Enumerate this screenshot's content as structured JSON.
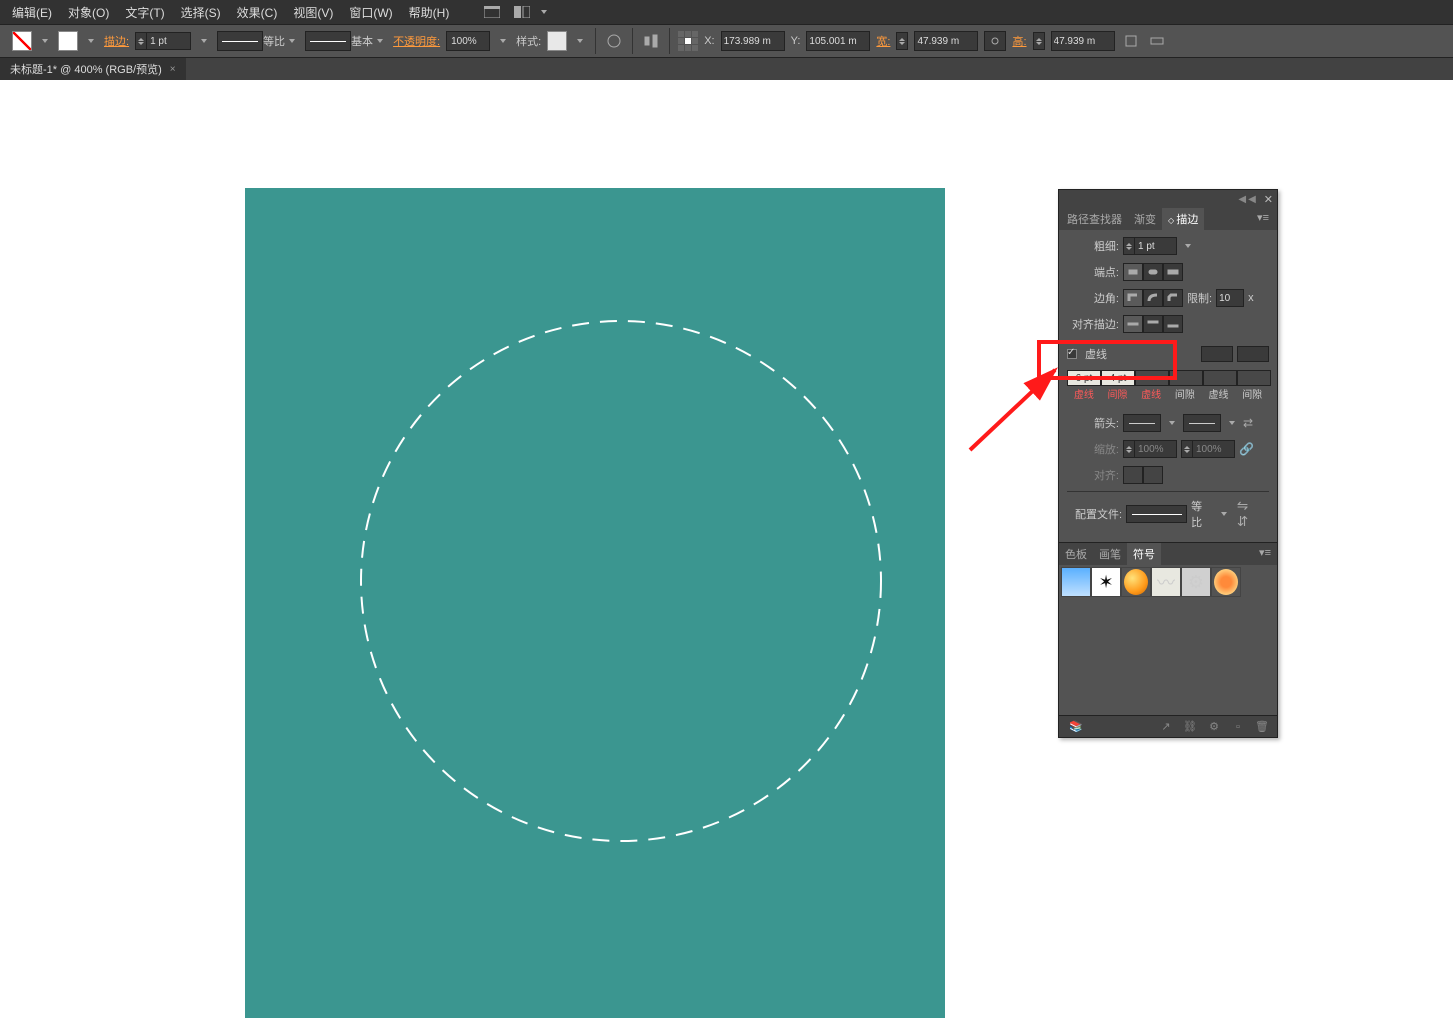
{
  "menu": {
    "edit": "编辑(E)",
    "object": "对象(O)",
    "text": "文字(T)",
    "select": "选择(S)",
    "effect": "效果(C)",
    "view": "视图(V)",
    "window": "窗口(W)",
    "help": "帮助(H)"
  },
  "controlbar": {
    "stroke_label": "描边:",
    "stroke_weight": "1 pt",
    "profile_text": "等比",
    "brush_text": "基本",
    "opacity_label": "不透明度:",
    "opacity_value": "100%",
    "style_label": "样式:",
    "x_label": "X:",
    "x_value": "173.989 m",
    "y_label": "Y:",
    "y_value": "105.001 m",
    "w_label": "宽:",
    "w_value": "47.939 m",
    "h_label": "高:",
    "h_value": "47.939 m"
  },
  "doc_tab": {
    "title": "未标题-1* @ 400% (RGB/预览)",
    "close": "×"
  },
  "stroke_panel": {
    "tab1": "路径查找器",
    "tab2": "渐变",
    "tab3": "描边",
    "weight_label": "粗细:",
    "weight_value": "1 pt",
    "cap_label": "端点:",
    "corner_label": "边角:",
    "limit_label": "限制:",
    "limit_value": "10",
    "limit_unit": "x",
    "align_label": "对齐描边:",
    "dash_label": "虚线",
    "dash1": "6 pt",
    "gap1": "4 pt",
    "dash2": "",
    "gap2": "",
    "dash3": "",
    "gap3": "",
    "dash_lbl": "虚线",
    "gap_lbl": "间隙",
    "arrow_label": "箭头:",
    "scale_label": "缩放:",
    "scale1": "100%",
    "scale2": "100%",
    "align_arrow_label": "对齐:",
    "profile_label": "配置文件:",
    "profile_text": "等比"
  },
  "symbols_panel": {
    "tab1": "色板",
    "tab2": "画笔",
    "tab3": "符号"
  }
}
